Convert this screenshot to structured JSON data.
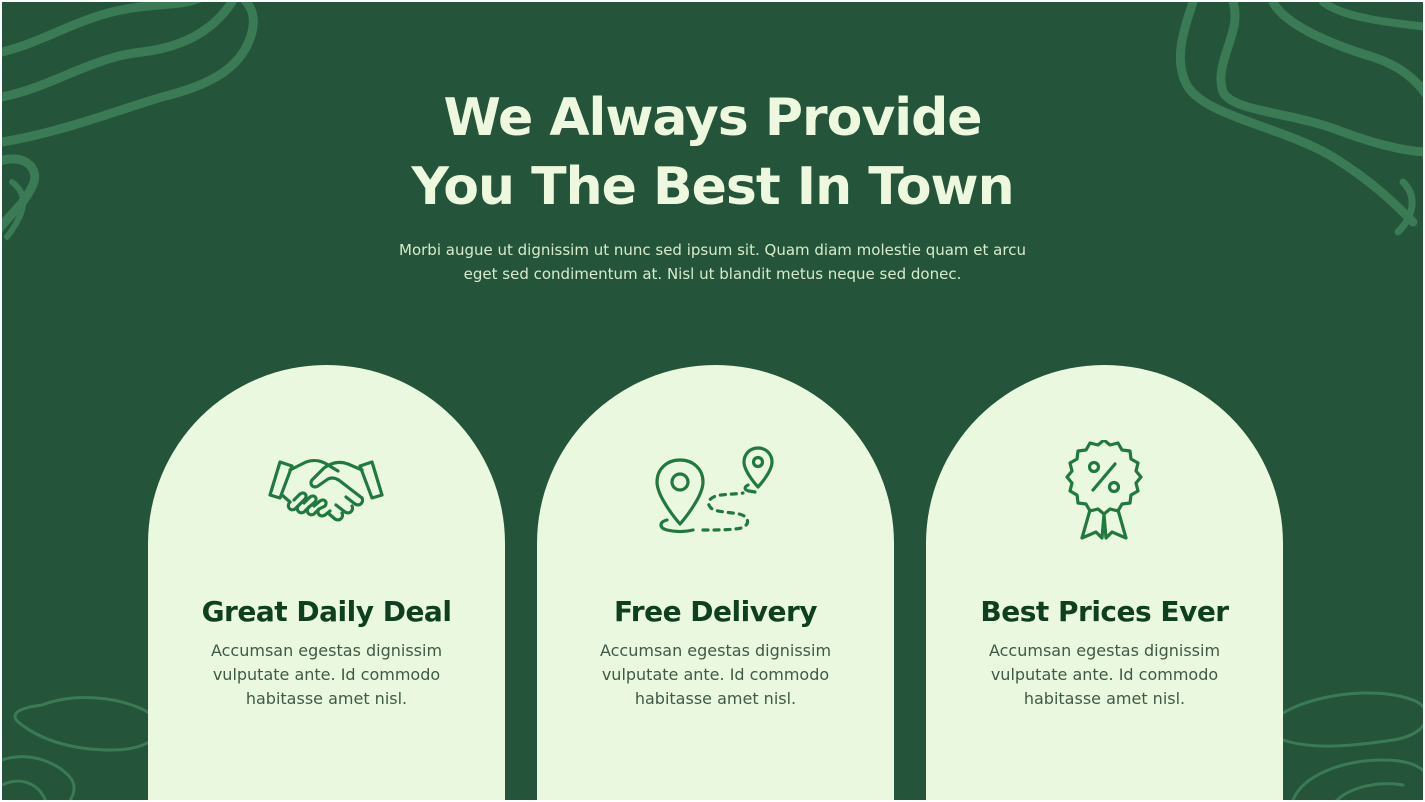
{
  "hero": {
    "title_line1": "We Always Provide",
    "title_line2": "You The Best In Town",
    "subtitle": "Morbi augue ut dignissim ut nunc sed ipsum sit. Quam diam molestie quam et arcu eget sed condimentum at. Nisl ut blandit metus neque sed donec."
  },
  "features": [
    {
      "icon": "handshake-icon",
      "title": "Great Daily Deal",
      "text": "Accumsan egestas dignissim vulputate ante. Id commodo habitasse amet nisl."
    },
    {
      "icon": "delivery-route-icon",
      "title": "Free Delivery",
      "text": "Accumsan egestas dignissim vulputate ante. Id commodo habitasse amet nisl."
    },
    {
      "icon": "discount-badge-icon",
      "title": "Best Prices Ever",
      "text": "Accumsan egestas dignissim vulputate ante. Id commodo habitasse amet nisl."
    }
  ],
  "colors": {
    "background": "#24543a",
    "card": "#ebf8e0",
    "heading_light": "#edf8df",
    "card_title": "#0e3f1f",
    "icon": "#1f7a40",
    "decoration": "#3a7a55"
  }
}
